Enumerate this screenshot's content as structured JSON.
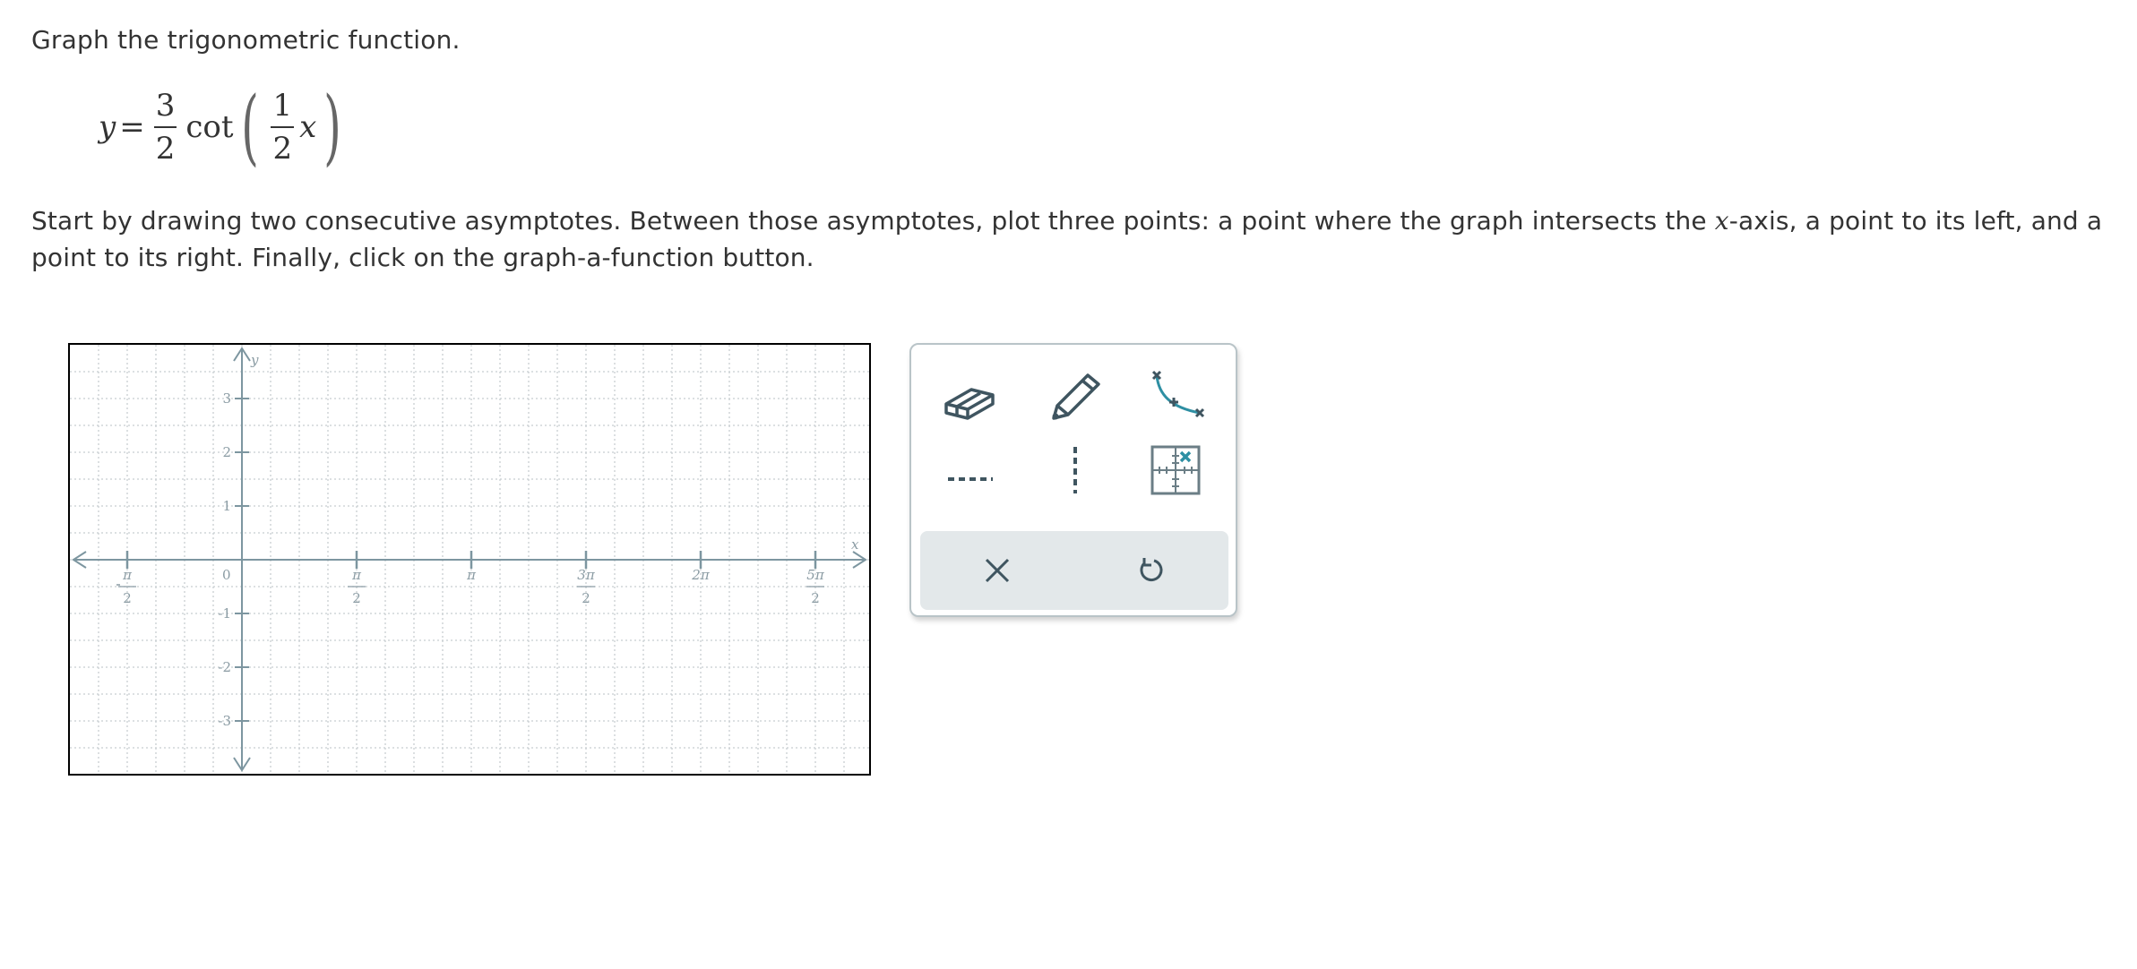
{
  "question": {
    "prompt": "Graph the trigonometric function.",
    "formula": {
      "lhs": "y",
      "equals": "=",
      "coef_num": "3",
      "coef_den": "2",
      "func": "cot",
      "arg_num": "1",
      "arg_den": "2",
      "arg_var": "x"
    },
    "instructions": {
      "part1": "Start by drawing two consecutive asymptotes. Between those asymptotes, plot three points: a point where the graph intersects the ",
      "xvar": "x",
      "part2": "-axis, a point to its left, and a point to its right. Finally, click on the graph-a-function button."
    }
  },
  "graph": {
    "axis_labels": {
      "x": "x",
      "y": "y"
    },
    "origin_label": "0",
    "y_ticks": [
      {
        "value": 3,
        "label": "3"
      },
      {
        "value": 2,
        "label": "2"
      },
      {
        "value": 1,
        "label": "1"
      },
      {
        "value": -1,
        "label": "-1"
      },
      {
        "value": -2,
        "label": "-2"
      },
      {
        "value": -3,
        "label": "-3"
      }
    ],
    "x_ticks": [
      {
        "value_halfpi": -1,
        "num": "π",
        "den": "2",
        "neg": true
      },
      {
        "value_halfpi": 1,
        "num": "π",
        "den": "2",
        "neg": false
      },
      {
        "value_halfpi": 2,
        "num": "π",
        "den": "",
        "neg": false
      },
      {
        "value_halfpi": 3,
        "num": "3π",
        "den": "2",
        "neg": false
      },
      {
        "value_halfpi": 4,
        "num": "2π",
        "den": "",
        "neg": false
      },
      {
        "value_halfpi": 5,
        "num": "5π",
        "den": "2",
        "neg": false
      }
    ],
    "x_range_halfpi": [
      -1.5,
      5.5
    ],
    "y_range": [
      -4,
      4
    ],
    "grid": true,
    "colors": {
      "axis": "#7d96a0",
      "grid": "#c8ced1",
      "tick_label": "#8a9ba3"
    }
  },
  "toolbar": {
    "tools": [
      {
        "name": "eraser-tool",
        "icon": "eraser-icon"
      },
      {
        "name": "pencil-tool",
        "icon": "pencil-icon"
      },
      {
        "name": "graph-a-function-tool",
        "icon": "curve-points-icon"
      },
      {
        "name": "horizontal-asymptote-tool",
        "icon": "horizontal-dashed-line-icon"
      },
      {
        "name": "vertical-asymptote-tool",
        "icon": "vertical-dashed-line-icon"
      },
      {
        "name": "point-grid-tool",
        "icon": "grid-point-icon"
      }
    ],
    "actions": [
      {
        "name": "clear-button",
        "icon": "close-icon"
      },
      {
        "name": "undo-button",
        "icon": "undo-icon"
      }
    ],
    "colors": {
      "icon": "#3f5560",
      "accent": "#2e8fa3",
      "action_bg": "#e3e8ea"
    }
  }
}
